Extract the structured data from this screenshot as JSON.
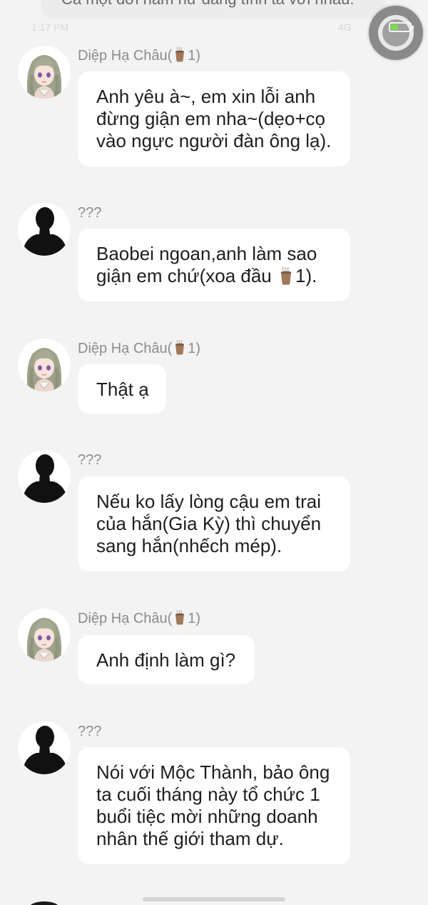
{
  "top_partial_message": "Cả một đời nắm nữ đang tình ta với nhau.",
  "status_faint_left": "1:17 PM",
  "status_faint_right": "4G",
  "messages": [
    {
      "sender": "Diệp Hạ Châu(",
      "sender_suffix": "1)",
      "avatar": "anime-girl-avatar",
      "lines": [
        "Anh yêu à~, em xin lỗi anh",
        "đừng giận em nha~(dẹo+cọ",
        "vào ngực người đàn ông lạ)."
      ]
    },
    {
      "sender": "???",
      "avatar": "silhouette-avatar",
      "lines": [
        "Baobei ngoan,anh làm sao",
        "giận em chứ(xoa đầu ",
        "1)."
      ]
    },
    {
      "sender": "Diệp Hạ Châu(",
      "sender_suffix": "1)",
      "avatar": "anime-girl-avatar",
      "lines": [
        "Thật ạ"
      ]
    },
    {
      "sender": "???",
      "avatar": "silhouette-avatar",
      "lines": [
        "Nếu ko lấy lòng cậu em trai",
        "của hắn(Gia Kỳ) thì chuyển",
        "sang hắn(nhếch mép)."
      ]
    },
    {
      "sender": "Diệp Hạ Châu(",
      "sender_suffix": "1)",
      "avatar": "anime-girl-avatar",
      "lines": [
        "Anh định làm gì?"
      ]
    },
    {
      "sender": "???",
      "avatar": "silhouette-avatar",
      "lines": [
        "Nói với Mộc Thành, bảo ông",
        "ta cuối tháng này tổ chức 1",
        "buổi tiệc mời những doanh",
        "nhân thế giới tham dự."
      ]
    }
  ],
  "colors": {
    "background": "#f3f3f3",
    "bubble": "#ffffff",
    "name_text": "#8c8c8c",
    "message_text": "#1e1e1e",
    "cup_icon": "#a0785a"
  }
}
